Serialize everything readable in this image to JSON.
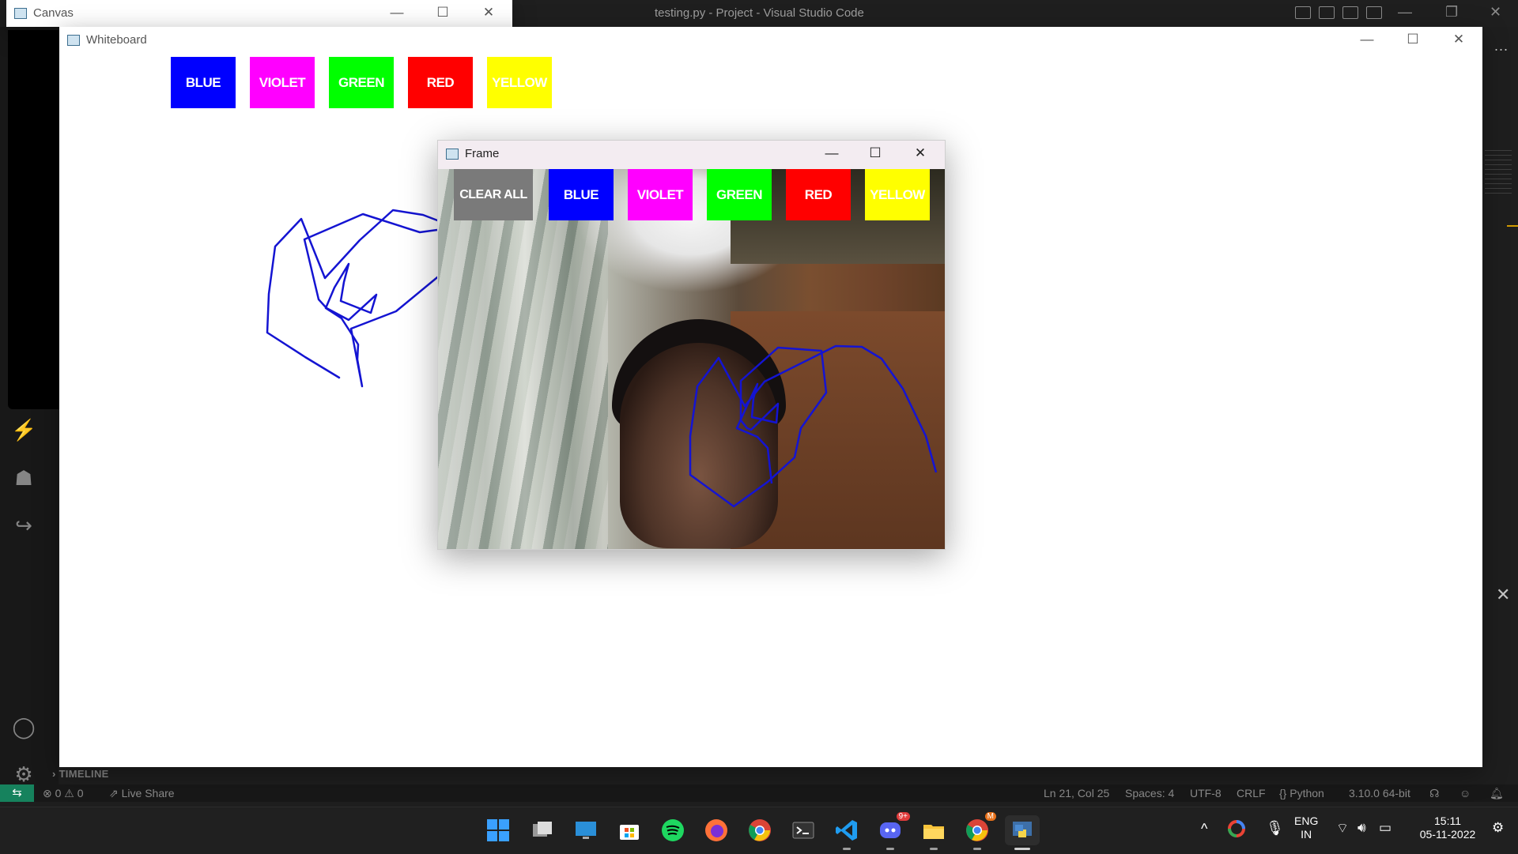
{
  "vscode": {
    "title": "testing.py - Project - Visual Studio Code",
    "timeline_label": "TIMELINE",
    "more": "...",
    "status": {
      "problems": "⊗ 0 ⚠ 0",
      "live_share": "Live Share",
      "position": "Ln 21, Col 25",
      "spaces": "Spaces: 4",
      "encoding": "UTF-8",
      "eol": "CRLF",
      "language": "Python",
      "interpreter": "3.10.0 64-bit"
    }
  },
  "windows": {
    "canvas": {
      "title": "Canvas"
    },
    "whiteboard": {
      "title": "Whiteboard",
      "buttons": [
        {
          "label": "BLUE",
          "color": "#0000ff"
        },
        {
          "label": "VIOLET",
          "color": "#ff00ff"
        },
        {
          "label": "GREEN",
          "color": "#00ff00"
        },
        {
          "label": "RED",
          "color": "#ff0000"
        },
        {
          "label": "YELLOW",
          "color": "#ffff00"
        }
      ],
      "stroke_color": "#1414d2"
    },
    "frame": {
      "title": "Frame",
      "buttons": [
        {
          "label": "CLEAR ALL",
          "color": "#7a7a7a"
        },
        {
          "label": "BLUE",
          "color": "#0000ff"
        },
        {
          "label": "VIOLET",
          "color": "#ff00ff"
        },
        {
          "label": "GREEN",
          "color": "#00ff00"
        },
        {
          "label": "RED",
          "color": "#ff0000"
        },
        {
          "label": "YELLOW",
          "color": "#ffff00"
        }
      ]
    }
  },
  "taskbar": {
    "apps": [
      "start-icon",
      "task-view-icon",
      "desktop-icon",
      "store-icon",
      "spotify-icon",
      "firefox-icon",
      "chrome-icon",
      "terminal-icon",
      "vscode-icon",
      "discord-icon",
      "file-explorer-icon",
      "chrome-profile-icon",
      "python-icon"
    ],
    "discord_badge": "9+",
    "chrome_badge": "M",
    "language_line1": "ENG",
    "language_line2": "IN",
    "time": "15:11",
    "date": "05-11-2022"
  }
}
